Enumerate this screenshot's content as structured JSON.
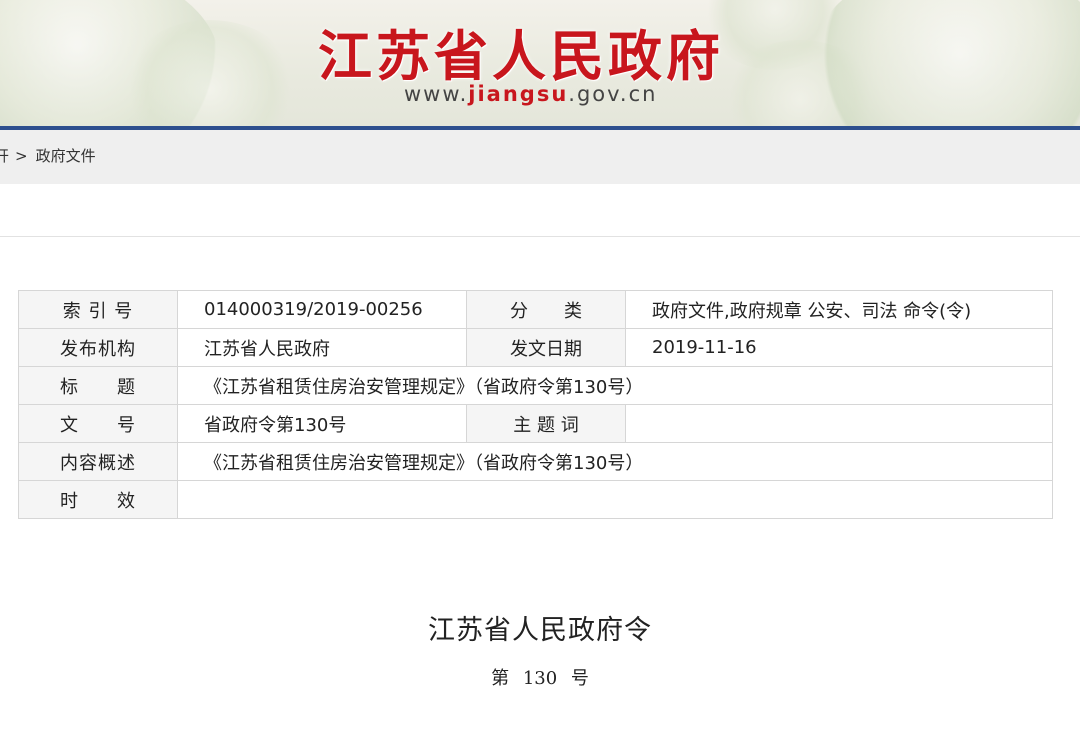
{
  "header": {
    "site_name": "江苏省人民政府",
    "url_prefix": "www.",
    "url_domain": "jiangsu",
    "url_suffix": ".gov.cn"
  },
  "breadcrumb": {
    "previous": "开",
    "separator": ">",
    "current": "政府文件"
  },
  "meta_table": {
    "index_label": "索 引 号",
    "index_value": "014000319/2019-00256",
    "category_label": "分　　类",
    "category_value": "政府文件,政府规章 公安、司法 命令(令)",
    "issuer_label": "发布机构",
    "issuer_value": "江苏省人民政府",
    "date_label": "发文日期",
    "date_value": "2019-11-16",
    "title_label": "标　　题",
    "title_value": "《江苏省租赁住房治安管理规定》（省政府令第130号）",
    "docno_label": "文　　号",
    "docno_value": "省政府令第130号",
    "keywords_label": "主 题 词",
    "keywords_value": "",
    "summary_label": "内容概述",
    "summary_value": "《江苏省租赁住房治安管理规定》（省政府令第130号）",
    "validity_label": "时　　效",
    "validity_value": ""
  },
  "document": {
    "title": "江苏省人民政府令",
    "number": "第 130 号"
  }
}
